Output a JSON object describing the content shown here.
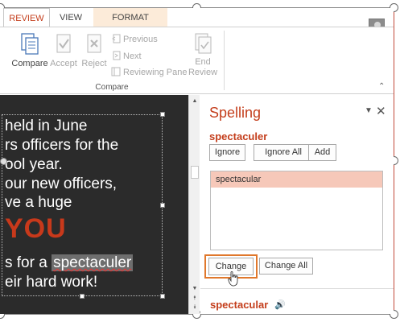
{
  "tabs": [
    "REVIEW",
    "VIEW",
    "FORMAT"
  ],
  "ribbon": {
    "compare": "Compare",
    "accept": "Accept",
    "reject": "Reject",
    "previous": "Previous",
    "next": "Next",
    "reviewing_pane": "Reviewing Pane",
    "end_review_line1": "End",
    "end_review_line2": "Review",
    "group_label": "Compare"
  },
  "slide": {
    "lines": [
      "held in June",
      "rs officers for the",
      "ool year.",
      "our new officers,",
      "ve a huge",
      "YOU",
      "s for a",
      "spectaculer",
      "eir hard work!"
    ]
  },
  "spelling": {
    "title": "Spelling",
    "misspelled": "spectaculer",
    "ignore": "Ignore",
    "ignore_all": "Ignore All",
    "add": "Add",
    "suggestions": [
      "spectacular"
    ],
    "change": "Change",
    "change_all": "Change All",
    "definition_word": "spectacular"
  },
  "colors": {
    "accent": "#c43e1c",
    "slide_bg": "#2b2b2b",
    "suggestion_selected": "#f6c8b9",
    "highlight_border": "#e0782c",
    "format_tab": "#fcebd9"
  },
  "icons": [
    "compare-icon",
    "accept-icon",
    "reject-icon",
    "previous-icon",
    "next-icon",
    "reviewing-pane-icon",
    "end-review-icon",
    "avatar",
    "speaker-icon",
    "close-icon",
    "pane-menu-icon"
  ]
}
